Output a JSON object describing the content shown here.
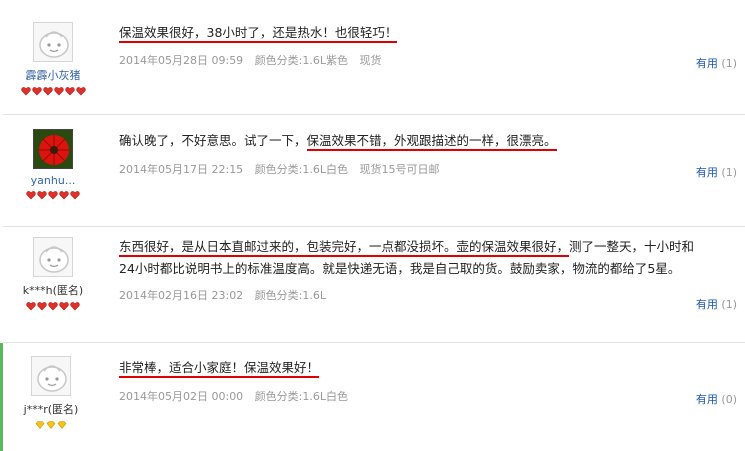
{
  "reviews": [
    {
      "user": "霹霹小灰猪",
      "badge_count": 6,
      "badge_type": "red-heart",
      "text_segments": [
        {
          "t": "保温效果很好，38小时了，还是热水！也很轻巧！",
          "u": true
        }
      ],
      "date": "2014年05月28日 09:59",
      "spec": "颜色分类:1.6L紫色",
      "ship": "现货",
      "useful_label": "有用",
      "useful_count": "(1)"
    },
    {
      "user": "yanhu...",
      "badge_count": 5,
      "badge_type": "red-heart",
      "text_segments": [
        {
          "t": "确认晚了，不好意思。试了一下，",
          "u": false
        },
        {
          "t": "保温效果不错，外观跟描述的一样，很漂亮。",
          "u": true
        }
      ],
      "date": "2014年05月17日 22:15",
      "spec": "颜色分类:1.6L白色",
      "ship": "现货15号可日邮",
      "useful_label": "有用",
      "useful_count": "(1)"
    },
    {
      "user": "k***h(匿名)",
      "badge_count": 5,
      "badge_type": "red-heart",
      "text_segments": [
        {
          "t": "东西很好，是从日本直邮过来的，包装完好，一点都没损坏。壶的保温效果很好，",
          "u": true
        },
        {
          "t": "测了一整天，十小时和",
          "u": false
        }
      ],
      "text_line2": "24小时都比说明书上的标准温度高。就是快递无语，我是自己取的货。鼓励卖家，物流的都给了5星。",
      "date": "2014年02月16日 23:02",
      "spec": "颜色分类:1.6L",
      "ship": "",
      "useful_label": "有用",
      "useful_count": "(1)"
    },
    {
      "user": "j***r(匿名)",
      "badge_count": 3,
      "badge_type": "yellow-diamond",
      "text_segments": [
        {
          "t": "非常棒，适合小家庭！保温效果好！",
          "u": true
        }
      ],
      "date": "2014年05月02日 00:00",
      "spec": "颜色分类:1.6L白色",
      "ship": "",
      "useful_label": "有用",
      "useful_count": "(0)"
    }
  ]
}
